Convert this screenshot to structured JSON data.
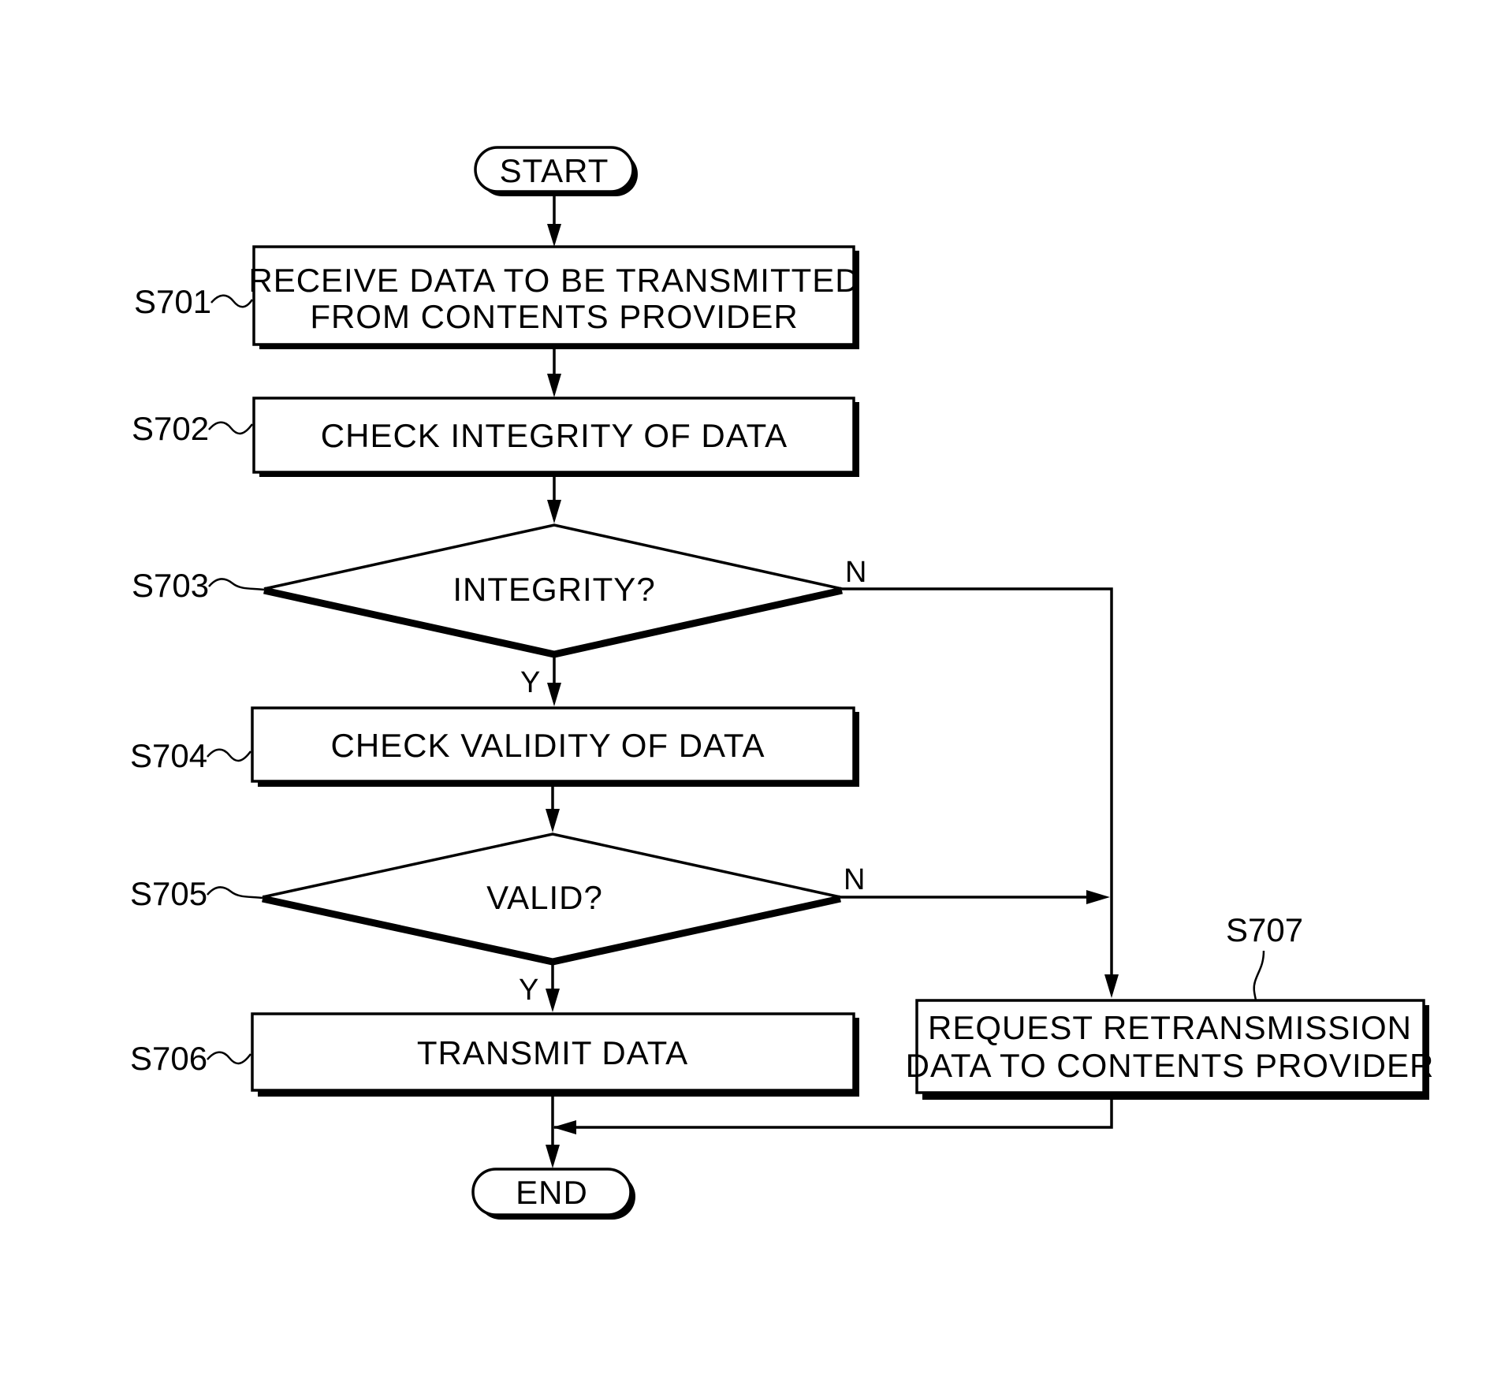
{
  "figure": {
    "type": "flowchart",
    "colors": {
      "stroke": "#000000",
      "background": "#ffffff"
    }
  },
  "nodes": {
    "start": {
      "label": "START",
      "shape": "terminator"
    },
    "s701": {
      "step": "S701",
      "lines": [
        "RECEIVE DATA TO BE TRANSMITTED",
        "FROM CONTENTS PROVIDER"
      ],
      "shape": "process"
    },
    "s702": {
      "step": "S702",
      "lines": [
        "CHECK INTEGRITY OF DATA"
      ],
      "shape": "process"
    },
    "s703": {
      "step": "S703",
      "lines": [
        "INTEGRITY?"
      ],
      "shape": "decision"
    },
    "s704": {
      "step": "S704",
      "lines": [
        "CHECK VALIDITY OF DATA"
      ],
      "shape": "process"
    },
    "s705": {
      "step": "S705",
      "lines": [
        "VALID?"
      ],
      "shape": "decision"
    },
    "s706": {
      "step": "S706",
      "lines": [
        "TRANSMIT DATA"
      ],
      "shape": "process"
    },
    "s707": {
      "step": "S707",
      "lines": [
        "REQUEST RETRANSMISSION",
        "DATA TO CONTENTS PROVIDER"
      ],
      "shape": "process"
    },
    "end": {
      "label": "END",
      "shape": "terminator"
    }
  },
  "branches": {
    "s703_yes": "Y",
    "s703_no": "N",
    "s705_yes": "Y",
    "s705_no": "N"
  },
  "edges": [
    {
      "from": "start",
      "to": "s701"
    },
    {
      "from": "s701",
      "to": "s702"
    },
    {
      "from": "s702",
      "to": "s703"
    },
    {
      "from": "s703",
      "to": "s704",
      "label": "Y"
    },
    {
      "from": "s703",
      "to": "s707",
      "label": "N"
    },
    {
      "from": "s704",
      "to": "s705"
    },
    {
      "from": "s705",
      "to": "s706",
      "label": "Y"
    },
    {
      "from": "s705",
      "to": "s707",
      "label": "N"
    },
    {
      "from": "s706",
      "to": "end"
    },
    {
      "from": "s707",
      "to": "end"
    }
  ]
}
